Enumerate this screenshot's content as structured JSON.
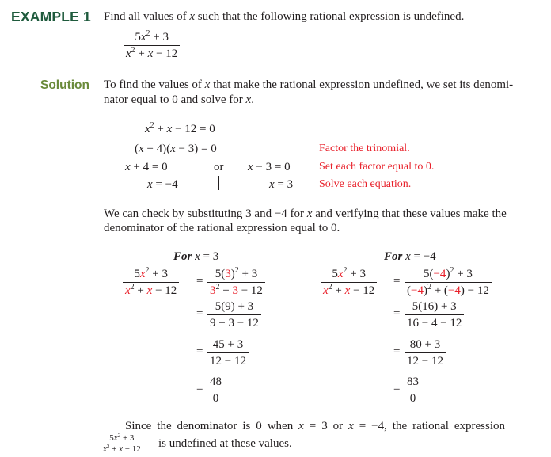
{
  "example": {
    "label": "EXAMPLE 1",
    "prompt": "Find all values of x such that the following rational expression is undefined.",
    "prompt_pre": "Find all values of ",
    "prompt_var": "x",
    "prompt_post": " such that the following rational expression is undefined.",
    "expr_num": "5x² + 3",
    "expr_den": "x² + x − 12"
  },
  "solution": {
    "label": "Solution",
    "intro_line1_pre": "To find the values of ",
    "intro_var": "x",
    "intro_line1_post": " that make the rational expression undefined, we set its denomi-",
    "intro_line2_pre": "nator equal to 0 and solve for ",
    "intro_line2_var": "x",
    "intro_line2_post": ".",
    "steps": [
      {
        "left": "x² + x − 12 = 0",
        "right": "",
        "note": ""
      },
      {
        "left": "(x + 4)(x − 3) = 0",
        "right": "",
        "note": "Factor the trinomial."
      },
      {
        "left": "x + 4 = 0",
        "connector": "or",
        "right": "x − 3 = 0",
        "note": "Set each factor equal to 0."
      },
      {
        "left": "x = −4",
        "right": "x = 3",
        "note": "Solve each equation."
      }
    ],
    "check_line1": "We can check by substituting 3 and −4 for x and verifying that these values make the",
    "check_line2": "denominator of the rational expression equal to 0."
  },
  "checks": [
    {
      "title_pre": "For ",
      "title_expr": "x = 3",
      "value": "3",
      "lhs_num": "5x² + 3",
      "lhs_den": "x² + x − 12",
      "rows": [
        {
          "num": "5(3)² + 3",
          "den": "3² + 3 − 12"
        },
        {
          "num": "5(9) + 3",
          "den": "9 + 3 − 12"
        },
        {
          "num": "45 + 3",
          "den": "12 − 12"
        },
        {
          "num": "48",
          "den": "0"
        }
      ]
    },
    {
      "title_pre": "For ",
      "title_expr": "x = −4",
      "value": "−4",
      "lhs_num": "5x² + 3",
      "lhs_den": "x² + x − 12",
      "rows": [
        {
          "num": "5(−4)² + 3",
          "den": "(−4)² + (−4) − 12"
        },
        {
          "num": "5(16) + 3",
          "den": "16 − 4 − 12"
        },
        {
          "num": "80 + 3",
          "den": "12 − 12"
        },
        {
          "num": "83",
          "den": "0"
        }
      ]
    }
  ],
  "conclusion": {
    "line1": "Since the denominator is 0 when x = 3 or x = −4, the rational expression",
    "line2_post": " is undefined at these values.",
    "expr_num": "5x² + 3",
    "expr_den": "x² + x − 12"
  },
  "colors": {
    "example_label": "#1e5a3c",
    "solution_label": "#6a8a3a",
    "highlight": "#e8202a",
    "text": "#231f20"
  }
}
